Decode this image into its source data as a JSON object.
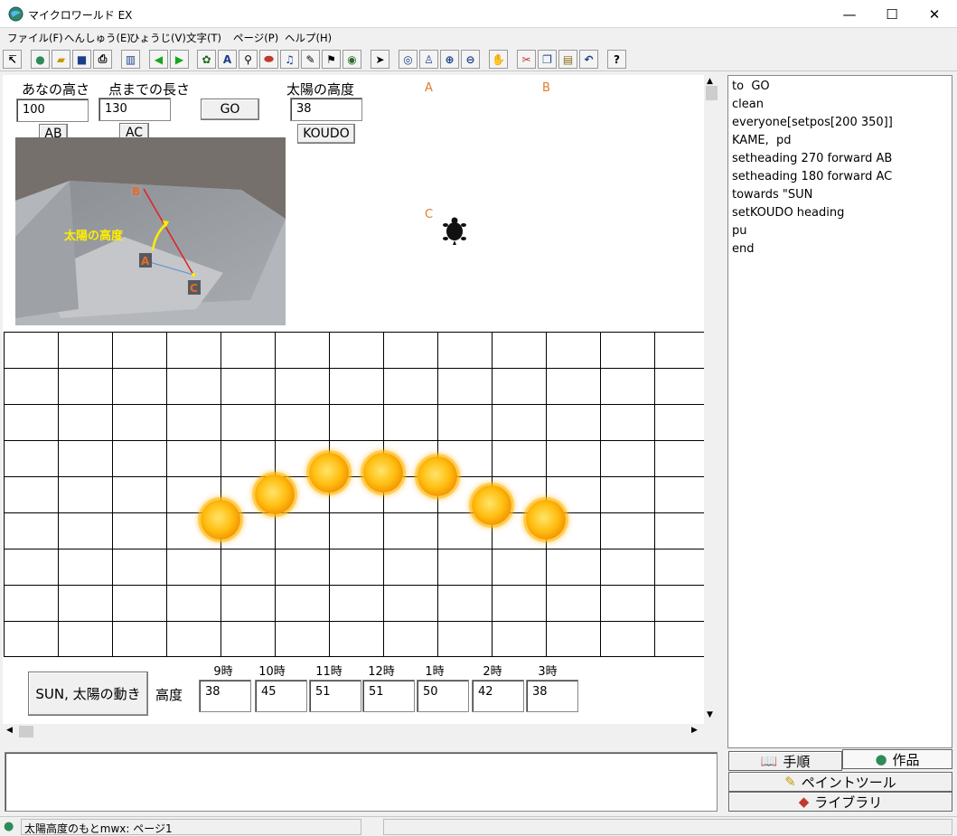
{
  "window": {
    "title": "マイクロワールド EX"
  },
  "menu": [
    "ファイル(F)",
    "へんしゅう(E)",
    "ひょうじ(V)",
    "文字(T)",
    "ページ(P)",
    "ヘルプ(H)"
  ],
  "workspace": {
    "label_hole_height": "あなの高さ",
    "label_point_length": "点までの長さ",
    "label_sun_altitude": "太陽の高度",
    "input_ab": "100",
    "input_ac": "130",
    "input_koudo": "38",
    "btn_ab": "AB",
    "btn_ac": "AC",
    "btn_go": "GO",
    "btn_koudo": "KOUDO",
    "point_a": "A",
    "point_b": "B",
    "point_c": "C",
    "photo_label_b": "B",
    "photo_label_a": "A",
    "photo_label_c": "C",
    "photo_caption": "太陽の高度"
  },
  "bottom": {
    "sun_button": "SUN, 太陽の動き",
    "altitude_label": "高度",
    "hours": [
      "9時",
      "10時",
      "11時",
      "12時",
      "1時",
      "2時",
      "3時"
    ],
    "altitudes": [
      "38",
      "45",
      "51",
      "51",
      "50",
      "42",
      "38"
    ]
  },
  "procedures": [
    "to  GO",
    "clean",
    "everyone[setpos[200 350]]",
    "KAME,  pd",
    "setheading 270 forward AB",
    "setheading 180 forward AC",
    "towards \"SUN",
    "setKOUDO heading",
    "pu",
    "end"
  ],
  "tabs": {
    "procedures": "手順",
    "works": "作品",
    "paint": "ペイントツール",
    "library": "ライブラリ"
  },
  "status": {
    "text": "太陽高度のもとmwx:  ページ1"
  },
  "colors": {
    "accent_orange": "#e07b2c",
    "sun": "#ffbe10"
  }
}
